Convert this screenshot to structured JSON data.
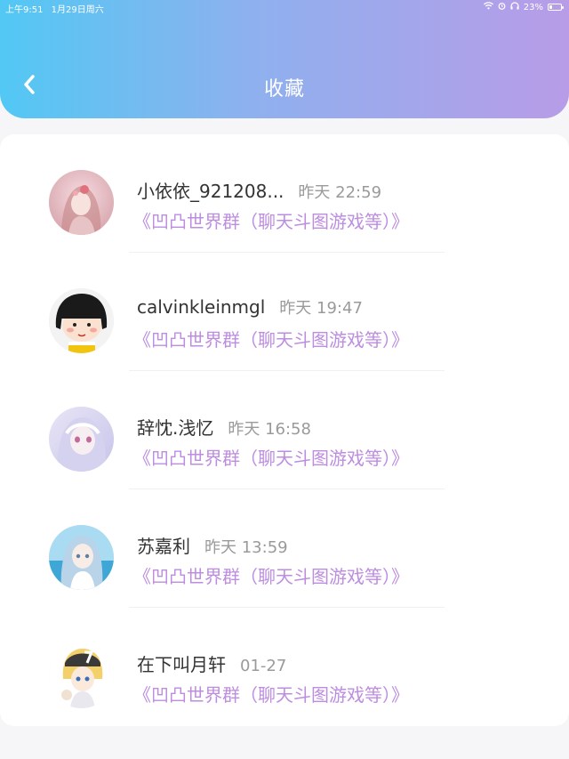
{
  "status_bar": {
    "time": "上午9:51",
    "date": "1月29日周六",
    "battery": "23%",
    "battery_level": 0.23
  },
  "header": {
    "title": "收藏",
    "back_icon": "chevron-left-icon"
  },
  "colors": {
    "gradient_start": "#52c8f4",
    "gradient_end": "#b89ce8",
    "group_text": "#bd8de0"
  },
  "favorites": [
    {
      "name": "小依依_921208...",
      "time": "昨天 22:59",
      "group": "《凹凸世界群（聊天斗图游戏等）》",
      "avatar": "anime-girl-pink-avatar"
    },
    {
      "name": "calvinkleinmgl",
      "time": "昨天 19:47",
      "group": "《凹凸世界群（聊天斗图游戏等）》",
      "avatar": "maruko-avatar"
    },
    {
      "name": "辞忱.浅忆",
      "time": "昨天 16:58",
      "group": "《凹凸世界群（聊天斗图游戏等）》",
      "avatar": "anime-girl-lavender-avatar"
    },
    {
      "name": "苏嘉利",
      "time": "昨天 13:59",
      "group": "《凹凸世界群（聊天斗图游戏等）》",
      "avatar": "anime-girl-sea-avatar"
    },
    {
      "name": "在下叫月轩",
      "time": "01-27",
      "group": "《凹凸世界群（聊天斗图游戏等）》",
      "avatar": "anime-boy-cap-avatar"
    }
  ]
}
